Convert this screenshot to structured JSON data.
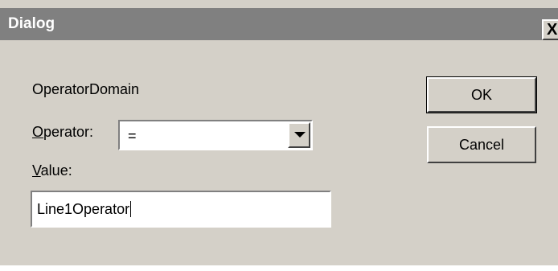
{
  "window": {
    "title": "Dialog",
    "close_glyph": "X"
  },
  "form": {
    "group_label": "OperatorDomain",
    "operator_label_accel": "O",
    "operator_label_rest": "perator:",
    "operator_value": "=",
    "value_label_accel": "V",
    "value_label_rest": "alue:",
    "value_text": "Line1Operator"
  },
  "buttons": {
    "ok_label": "OK",
    "cancel_label": "Cancel"
  },
  "icons": {
    "close": "close-icon",
    "dropdown": "dropdown-arrow-icon"
  },
  "colors": {
    "face": "#d4d0c8",
    "titlebar": "#808080",
    "title_text": "#ffffff"
  }
}
